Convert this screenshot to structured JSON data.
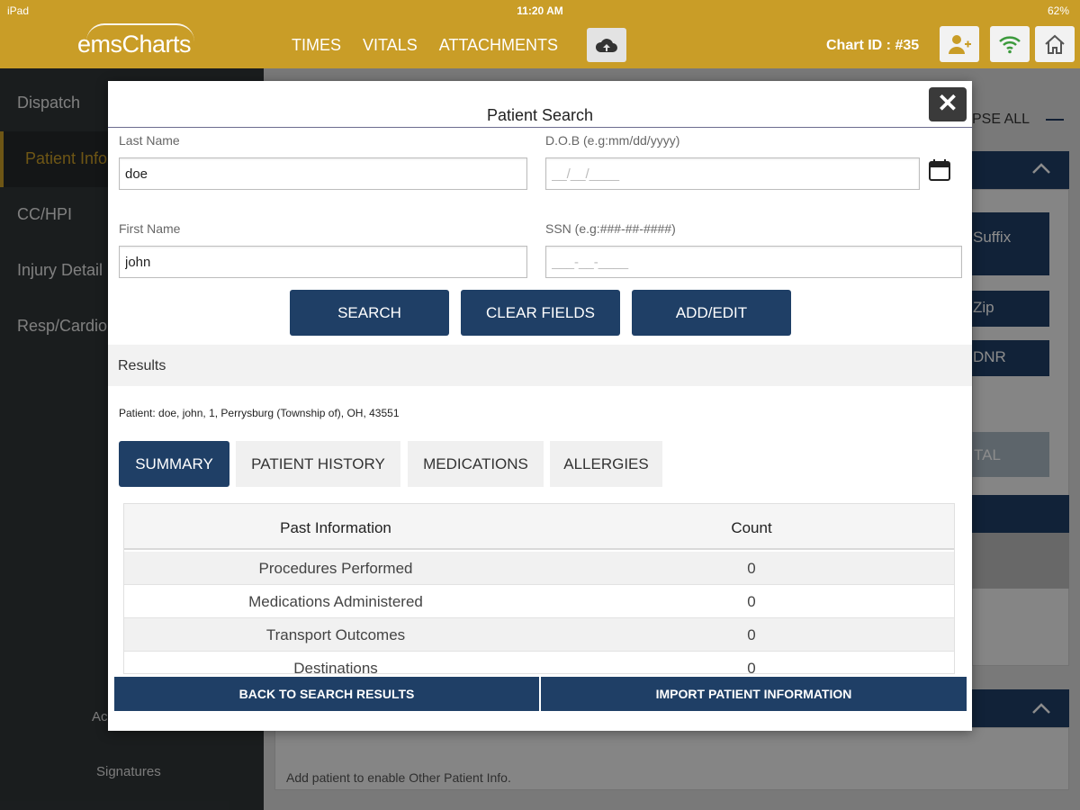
{
  "status": {
    "left": "iPad",
    "time": "11:20 AM",
    "right": "62%"
  },
  "app": {
    "logo": "emsCharts",
    "nav_tabs": [
      "TIMES",
      "VITALS",
      "ATTACHMENTS"
    ],
    "chart_id": "Chart ID : #35"
  },
  "sidebar": {
    "items": [
      {
        "label": "Dispatch"
      },
      {
        "label": "Patient Info"
      },
      {
        "label": "CC/HPI"
      },
      {
        "label": "Injury Detail"
      },
      {
        "label": "Resp/Cardio"
      }
    ],
    "bottom_items": [
      {
        "label": "Ac"
      },
      {
        "label": "Signatures"
      }
    ]
  },
  "background": {
    "collapse_all": "PSE ALL",
    "suffix": "Suffix",
    "zip": "Zip",
    "dnr": "DNR",
    "vital": "TAL",
    "note": "Add patient to enable Other Patient Info."
  },
  "modal": {
    "title": "Patient Search",
    "last_name": {
      "label": "Last Name",
      "value": "doe"
    },
    "dob": {
      "label": "D.O.B (e.g:mm/dd/yyyy)",
      "placeholder": "__/__/____"
    },
    "first_name": {
      "label": "First Name",
      "value": "john"
    },
    "ssn": {
      "label": "SSN (e.g:###-##-####)",
      "placeholder": "___-__-____"
    },
    "buttons": {
      "search": "SEARCH",
      "clear": "CLEAR FIELDS",
      "add_edit": "ADD/EDIT"
    },
    "results_label": "Results",
    "patient_line": "Patient: doe, john, 1, Perrysburg (Township of), OH, 43551",
    "tabs": [
      {
        "label": "SUMMARY"
      },
      {
        "label": "PATIENT HISTORY"
      },
      {
        "label": "MEDICATIONS"
      },
      {
        "label": "ALLERGIES"
      }
    ],
    "table": {
      "headers": [
        "Past Information",
        "Count"
      ],
      "rows": [
        {
          "label": "Procedures Performed",
          "count": "0"
        },
        {
          "label": "Medications Administered",
          "count": "0"
        },
        {
          "label": "Transport Outcomes",
          "count": "0"
        },
        {
          "label": "Destinations",
          "count": "0"
        }
      ]
    },
    "footer": {
      "back": "BACK TO SEARCH RESULTS",
      "import": "IMPORT PATIENT INFORMATION"
    }
  },
  "colors": {
    "brand_gold": "#c99d27",
    "navy": "#1f3f66",
    "sidebar": "#313638"
  }
}
